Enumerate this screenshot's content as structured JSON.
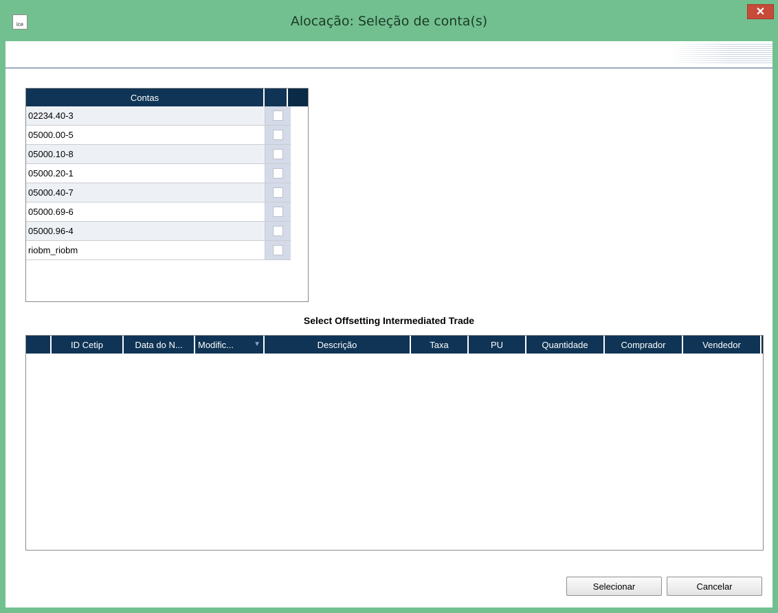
{
  "window": {
    "icon_text": "ice",
    "title": "Alocação: Seleção de conta(s)",
    "close_glyph": "✕"
  },
  "accounts": {
    "header": "Contas",
    "rows": [
      {
        "label": "02234.40-3",
        "checked": false
      },
      {
        "label": "05000.00-5",
        "checked": false
      },
      {
        "label": "05000.10-8",
        "checked": false
      },
      {
        "label": "05000.20-1",
        "checked": false
      },
      {
        "label": "05000.40-7",
        "checked": false
      },
      {
        "label": "05000.69-6",
        "checked": false
      },
      {
        "label": "05000.96-4",
        "checked": false
      },
      {
        "label": "riobm_riobm",
        "checked": false
      }
    ]
  },
  "trades": {
    "caption": "Select Offsetting Intermediated Trade",
    "columns": [
      {
        "label": ""
      },
      {
        "label": "ID Cetip"
      },
      {
        "label": "Data do N..."
      },
      {
        "label": "Modific..."
      },
      {
        "label": "Descrição"
      },
      {
        "label": "Taxa"
      },
      {
        "label": "PU"
      },
      {
        "label": "Quantidade"
      },
      {
        "label": "Comprador"
      },
      {
        "label": "Vendedor"
      }
    ],
    "sort_icon": "▼",
    "rows": []
  },
  "buttons": {
    "select_label": "Selecionar",
    "cancel_label": "Cancelar"
  }
}
